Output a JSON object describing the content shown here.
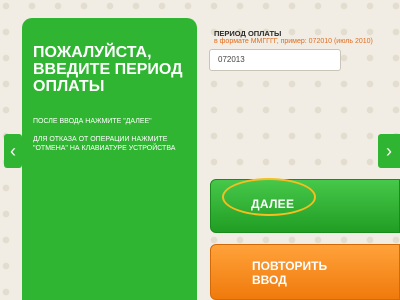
{
  "instructions": {
    "title": "ПОЖАЛУЙСТА, ВВЕДИТЕ ПЕРИОД ОПЛАТЫ",
    "hint_next": "ПОСЛЕ ВВОДА НАЖМИТЕ \"ДАЛЕЕ\"",
    "hint_cancel": "ДЛЯ ОТКАЗА ОТ ОПЕРАЦИИ НАЖМИТЕ \"ОТМЕНА\" НА КЛАВИАТУРЕ УСТРОЙСТВА"
  },
  "period_field": {
    "label": "ПЕРИОД ОПЛАТЫ",
    "example": "в формате ММГГГГ, пример: 072010 (июль 2010)",
    "value": "072013"
  },
  "buttons": {
    "next": "ДАЛЕЕ",
    "retry": "ПОВТОРИТЬ ВВОД"
  },
  "nav": {
    "left_icon": "chevron-left-icon",
    "right_icon": "chevron-right-icon",
    "left_glyph": "‹",
    "right_glyph": "›"
  },
  "colors": {
    "panel_green": "#2fb531",
    "accent_orange": "#f07a0c",
    "highlight_ring": "#f6be1f"
  }
}
